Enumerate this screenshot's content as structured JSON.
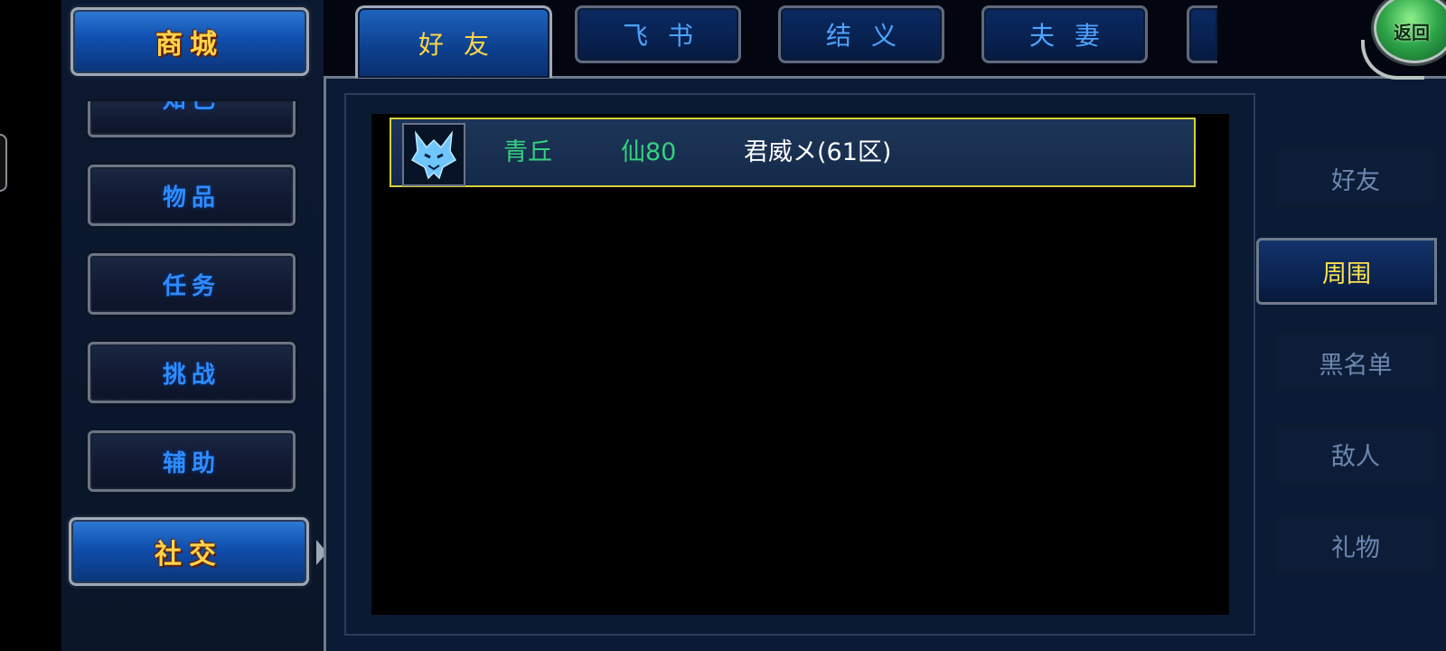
{
  "left_menu": {
    "shop_label": "商城",
    "items": [
      {
        "label": "知己",
        "active": false
      },
      {
        "label": "物品",
        "active": false
      },
      {
        "label": "任务",
        "active": false
      },
      {
        "label": "挑战",
        "active": false
      },
      {
        "label": "辅助",
        "active": false
      },
      {
        "label": "社交",
        "active": true
      }
    ]
  },
  "top_tabs": [
    {
      "label": "好友",
      "active": true
    },
    {
      "label": "飞书",
      "active": false
    },
    {
      "label": "结义",
      "active": false
    },
    {
      "label": "夫妻",
      "active": false
    }
  ],
  "return_button": {
    "label": "返回"
  },
  "friend_list": {
    "rows": [
      {
        "name": "青丘",
        "level": "仙80",
        "guild": "君威メ(61区)",
        "avatar_icon": "wolf-emblem-icon",
        "selected": true
      }
    ]
  },
  "sub_tabs": [
    {
      "label": "好友",
      "active": false
    },
    {
      "label": "周围",
      "active": true
    },
    {
      "label": "黑名单",
      "active": false
    },
    {
      "label": "敌人",
      "active": false
    },
    {
      "label": "礼物",
      "active": false
    }
  ],
  "colors": {
    "active_gold": "#ffd44a",
    "inactive_blue": "#4da3ff",
    "player_green": "#35d07f",
    "selection_border": "#d8d03a"
  }
}
